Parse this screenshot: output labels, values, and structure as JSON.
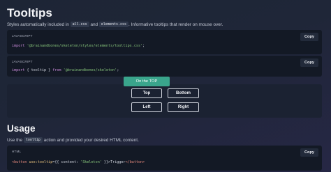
{
  "title": "Tooltips",
  "intro": {
    "before": "Styles automatically included in",
    "chip1": "all.css",
    "and": "and",
    "chip2": "elements.css",
    "after": ". Informative tooltips that render on mouse over."
  },
  "code_blocks": [
    {
      "lang": "JAVASCRIPT",
      "copy": "Copy",
      "tokens": [
        "import",
        " ",
        "'@brainandbones/skeleton/styles/elements/tooltips.css'",
        ";"
      ]
    },
    {
      "lang": "JAVASCRIPT",
      "copy": "Copy",
      "tokens": [
        "import",
        " { tooltip } ",
        "from",
        " ",
        "'@brainandbones/skeleton'",
        ";"
      ]
    },
    {
      "lang": "HTML",
      "copy": "Copy",
      "tokens": [
        "<button",
        " ",
        "use:tooltip",
        "={{ content: ",
        "'Skeleton'",
        " }}>Trigger",
        "</button>"
      ]
    }
  ],
  "demo": {
    "tooltip": "On the TOP",
    "buttons": [
      "Top",
      "Bottom",
      "Left",
      "Right"
    ]
  },
  "usage": {
    "title": "Usage",
    "before": "Use the",
    "chip": "tooltip",
    "after": "action and provided your desired HTML content."
  }
}
